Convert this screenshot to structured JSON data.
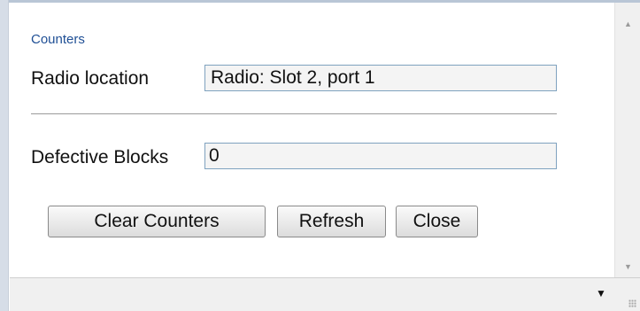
{
  "section": {
    "title": "Counters"
  },
  "fields": {
    "radio_location": {
      "label": "Radio location",
      "value": "Radio: Slot 2, port 1"
    },
    "defective_blocks": {
      "label": "Defective Blocks",
      "value": "0"
    }
  },
  "buttons": {
    "clear_counters": "Clear Counters",
    "refresh": "Refresh",
    "close": "Close"
  },
  "icons": {
    "scroll_up": "▲",
    "scroll_down": "▼",
    "status_dropdown": "▼"
  },
  "colors": {
    "section_title": "#1f4f95",
    "input_border": "#7fa2bf",
    "input_background": "#f4f4f4"
  }
}
